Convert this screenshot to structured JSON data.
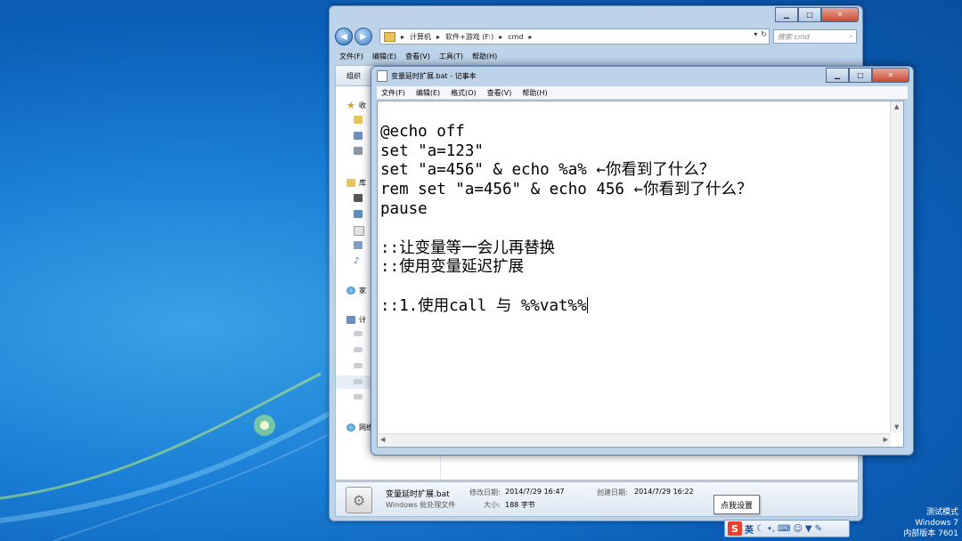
{
  "explorer": {
    "address": [
      "计算机",
      "软件+游戏 (F:)",
      "cmd"
    ],
    "search_placeholder": "搜索 cmd",
    "menu": [
      "文件(F)",
      "编辑(E)",
      "查看(V)",
      "工具(T)",
      "帮助(H)"
    ],
    "toolbar_label": "组织",
    "nav_items": [
      "收",
      "库",
      "家",
      "计",
      "网络"
    ],
    "status": {
      "filename": "变量延时扩展.bat",
      "type": "Windows 批处理文件",
      "modified_label": "修改日期:",
      "modified": "2014/7/29 16:47",
      "size_label": "大小:",
      "size": "188 字节",
      "created_label": "创建日期:",
      "created": "2014/7/29 16:22"
    }
  },
  "notepad": {
    "title": "变量延时扩展.bat - 记事本",
    "menu": [
      "文件(F)",
      "编辑(E)",
      "格式(O)",
      "查看(V)",
      "帮助(H)"
    ],
    "lines": [
      "@echo off",
      "set \"a=123\"",
      "set \"a=456\" & echo %a% ←你看到了什么？",
      "rem set \"a=456\" & echo 456 ←你看到了什么？",
      "pause",
      "",
      "::让变量等一会儿再替换",
      "::使用变量延迟扩展",
      "",
      "::1.使用call 与 %%vat%%"
    ]
  },
  "tooltip": "点我设置",
  "ime": {
    "logo": "S",
    "lang": "英"
  },
  "watermark": [
    "测试模式",
    "Windows 7",
    "内部版本 7601"
  ],
  "colors": {
    "desktop": "#1a7ed6",
    "window_frame": "#bcd3ea",
    "close_button": "#c74a32"
  }
}
